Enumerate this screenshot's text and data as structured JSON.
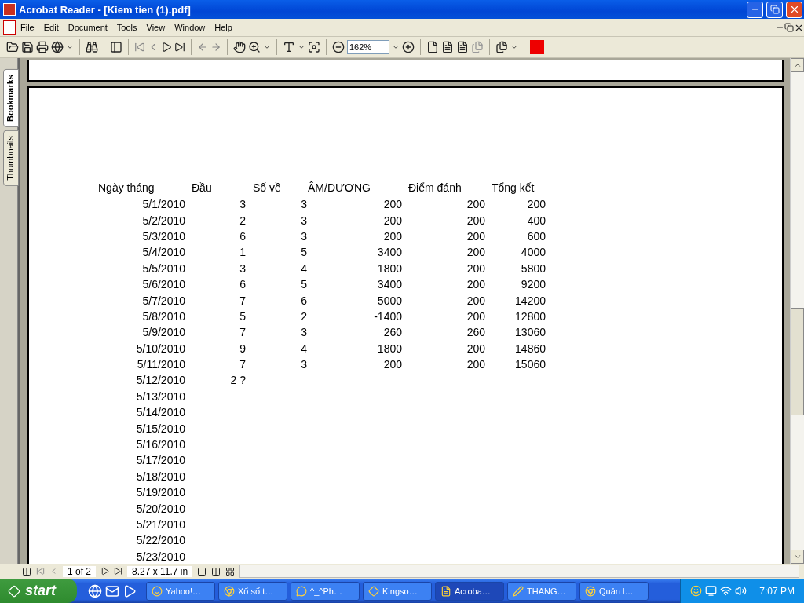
{
  "window": {
    "title": "Acrobat Reader - [Kiem tien (1).pdf]"
  },
  "menu": [
    "File",
    "Edit",
    "Document",
    "Tools",
    "View",
    "Window",
    "Help"
  ],
  "toolbar": {
    "zoom": "162%"
  },
  "side_tabs": [
    {
      "label": "Bookmarks",
      "selected": true
    },
    {
      "label": "Thumbnails",
      "selected": false
    }
  ],
  "table": {
    "columns": [
      "Ngày tháng",
      "Đầu",
      "Số về",
      "ÂM/DƯƠNG",
      "Điểm đánh",
      "Tổng kết"
    ],
    "rows": [
      {
        "date": "5/1/2010",
        "cells": [
          "3",
          "3",
          "200",
          "200",
          "200"
        ]
      },
      {
        "date": "5/2/2010",
        "cells": [
          "2",
          "3",
          "200",
          "200",
          "400"
        ]
      },
      {
        "date": "5/3/2010",
        "cells": [
          "6",
          "3",
          "200",
          "200",
          "600"
        ]
      },
      {
        "date": "5/4/2010",
        "cells": [
          "1",
          "5",
          "3400",
          "200",
          "4000"
        ]
      },
      {
        "date": "5/5/2010",
        "cells": [
          "3",
          "4",
          "1800",
          "200",
          "5800"
        ]
      },
      {
        "date": "5/6/2010",
        "cells": [
          "6",
          "5",
          "3400",
          "200",
          "9200"
        ]
      },
      {
        "date": "5/7/2010",
        "cells": [
          "7",
          "6",
          "5000",
          "200",
          "14200"
        ]
      },
      {
        "date": "5/8/2010",
        "cells": [
          "5",
          "2",
          "-1400",
          "200",
          "12800"
        ]
      },
      {
        "date": "5/9/2010",
        "cells": [
          "7",
          "3",
          "260",
          "260",
          "13060"
        ]
      },
      {
        "date": "5/10/2010",
        "cells": [
          "9",
          "4",
          "1800",
          "200",
          "14860"
        ]
      },
      {
        "date": "5/11/2010",
        "cells": [
          "7",
          "3",
          "200",
          "200",
          "15060"
        ]
      },
      {
        "date": "5/12/2010",
        "cells": [
          "2 ?"
        ]
      },
      {
        "date": "5/13/2010",
        "cells": []
      },
      {
        "date": "5/14/2010",
        "cells": []
      },
      {
        "date": "5/15/2010",
        "cells": []
      },
      {
        "date": "5/16/2010",
        "cells": []
      },
      {
        "date": "5/17/2010",
        "cells": []
      },
      {
        "date": "5/18/2010",
        "cells": []
      },
      {
        "date": "5/19/2010",
        "cells": []
      },
      {
        "date": "5/20/2010",
        "cells": []
      },
      {
        "date": "5/21/2010",
        "cells": []
      },
      {
        "date": "5/22/2010",
        "cells": []
      },
      {
        "date": "5/23/2010",
        "cells": []
      }
    ]
  },
  "status_bar": {
    "page": "1 of 2",
    "size": "8.27 x 11.7 in"
  },
  "taskbar": {
    "start": "start",
    "tasks": [
      {
        "label": "Yahoo!…",
        "selected": false
      },
      {
        "label": "Xổ số t…",
        "selected": false
      },
      {
        "label": "^_^Ph…",
        "selected": false
      },
      {
        "label": "Kingso…",
        "selected": false
      },
      {
        "label": "Acroba…",
        "selected": true
      },
      {
        "label": "THANG…",
        "selected": false
      },
      {
        "label": "Quản l…",
        "selected": false
      }
    ],
    "clock": "7:07 PM"
  }
}
